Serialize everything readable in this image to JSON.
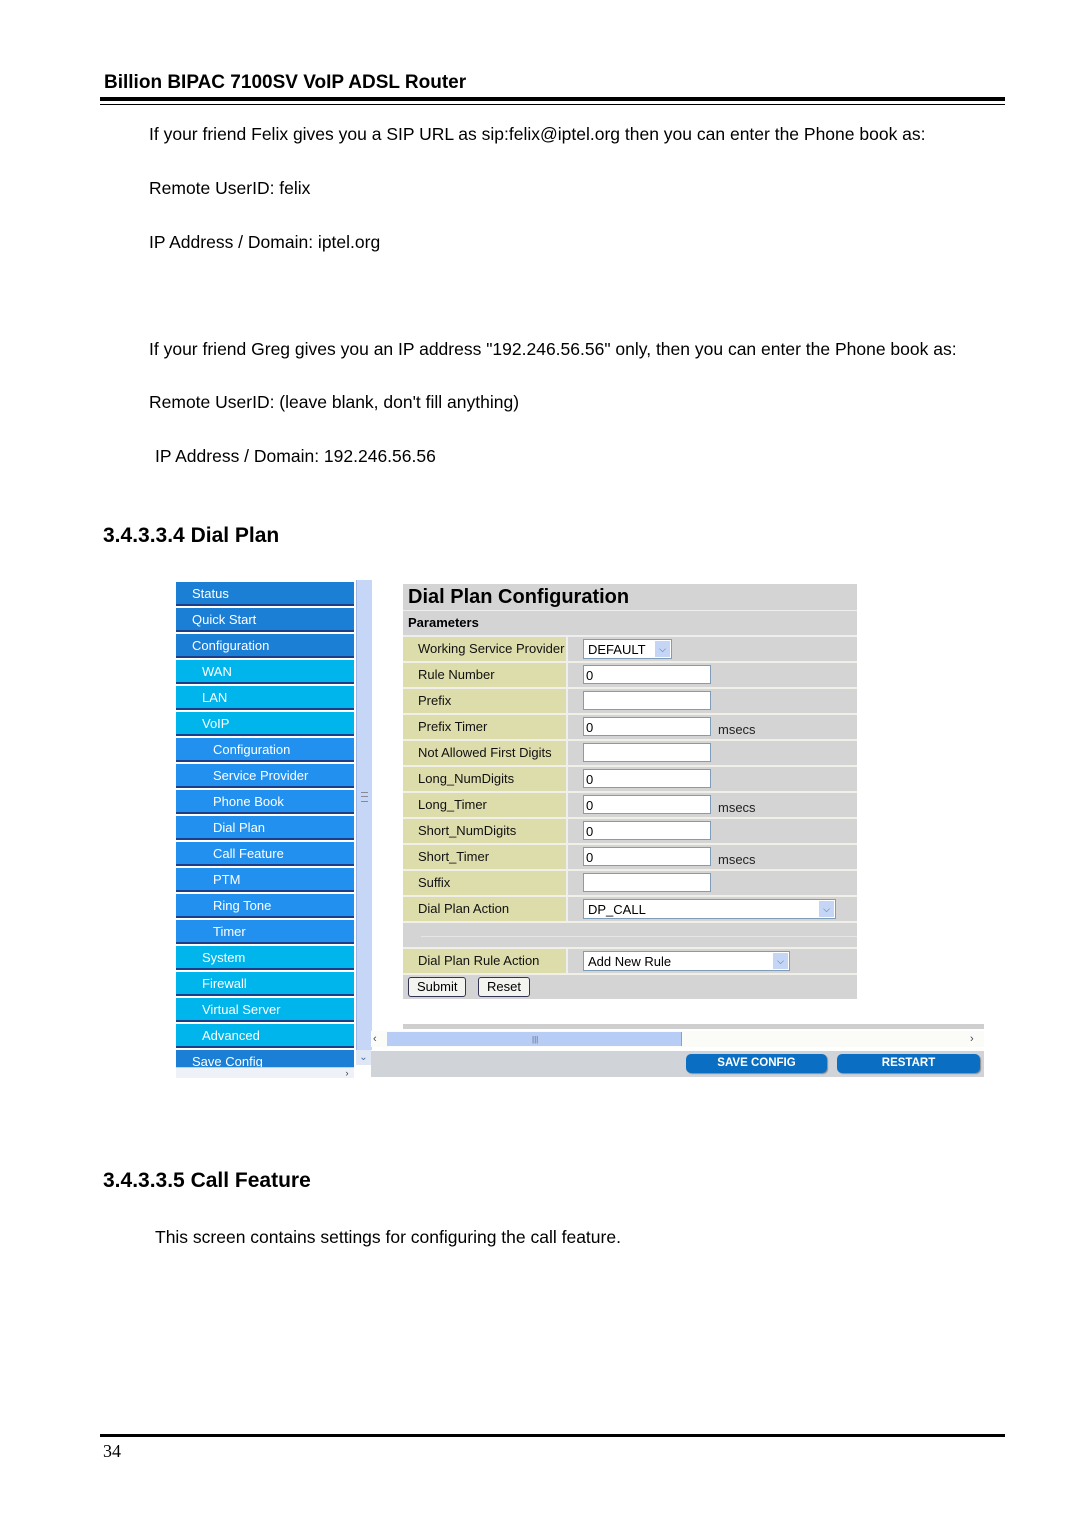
{
  "doc": {
    "header": "Billion BIPAC 7100SV VoIP ADSL Router",
    "paragraphs": [
      "If your friend Felix gives you a SIP URL as sip:felix@iptel.org then you can enter the Phone book as:",
      "Remote UserID: felix",
      "IP Address / Domain: iptel.org",
      "If your friend Greg gives you an IP address \"192.246.56.56\" only, then you can enter the Phone book as:",
      "Remote UserID: (leave blank, don't fill anything)",
      "IP Address / Domain: 192.246.56.56"
    ],
    "section_dial_plan": "3.4.3.3.4 Dial Plan",
    "section_call_feature": "3.4.3.3.5 Call Feature",
    "call_feature_text": "This screen contains settings for configuring the call feature.",
    "page_number": "34"
  },
  "nav": {
    "items": [
      {
        "label": "Status",
        "level": 1
      },
      {
        "label": "Quick Start",
        "level": 1
      },
      {
        "label": "Configuration",
        "level": 1
      },
      {
        "label": "WAN",
        "level": 2
      },
      {
        "label": "LAN",
        "level": 2
      },
      {
        "label": "VoIP",
        "level": 2
      },
      {
        "label": "Configuration",
        "level": 3
      },
      {
        "label": "Service Provider",
        "level": 3
      },
      {
        "label": "Phone Book",
        "level": 3
      },
      {
        "label": "Dial Plan",
        "level": 3
      },
      {
        "label": "Call Feature",
        "level": 3
      },
      {
        "label": "PTM",
        "level": 3
      },
      {
        "label": "Ring Tone",
        "level": 3
      },
      {
        "label": "Timer",
        "level": 3
      },
      {
        "label": "System",
        "level": 2
      },
      {
        "label": "Firewall",
        "level": 2
      },
      {
        "label": "Virtual Server",
        "level": 2
      },
      {
        "label": "Advanced",
        "level": 2
      },
      {
        "label": "Save Config",
        "level": 1
      }
    ]
  },
  "panel": {
    "title": "Dial Plan Configuration",
    "params_label": "Parameters",
    "working_service_provider": {
      "label": "Working Service Provider",
      "value": "DEFAULT"
    },
    "rule_number": {
      "label": "Rule Number",
      "value": "0"
    },
    "prefix": {
      "label": "Prefix",
      "value": ""
    },
    "prefix_timer": {
      "label": "Prefix Timer",
      "value": "0",
      "unit": "msecs"
    },
    "not_allowed_first_digits": {
      "label": "Not Allowed First Digits",
      "value": ""
    },
    "long_numdigits": {
      "label": "Long_NumDigits",
      "value": "0"
    },
    "long_timer": {
      "label": "Long_Timer",
      "value": "0",
      "unit": "msecs"
    },
    "short_numdigits": {
      "label": "Short_NumDigits",
      "value": "0"
    },
    "short_timer": {
      "label": "Short_Timer",
      "value": "0",
      "unit": "msecs"
    },
    "suffix": {
      "label": "Suffix",
      "value": ""
    },
    "dial_plan_action": {
      "label": "Dial Plan Action",
      "value": "DP_CALL"
    },
    "dial_plan_rule_action": {
      "label": "Dial Plan Rule Action",
      "value": "Add New Rule"
    },
    "submit_label": "Submit",
    "reset_label": "Reset"
  },
  "bottom": {
    "save_config_label": "SAVE CONFIG",
    "restart_label": "RESTART"
  },
  "icons": {
    "dropdown": "chevron-down-icon",
    "scroll_left": "chevron-left-icon",
    "scroll_right": "chevron-right-icon"
  }
}
